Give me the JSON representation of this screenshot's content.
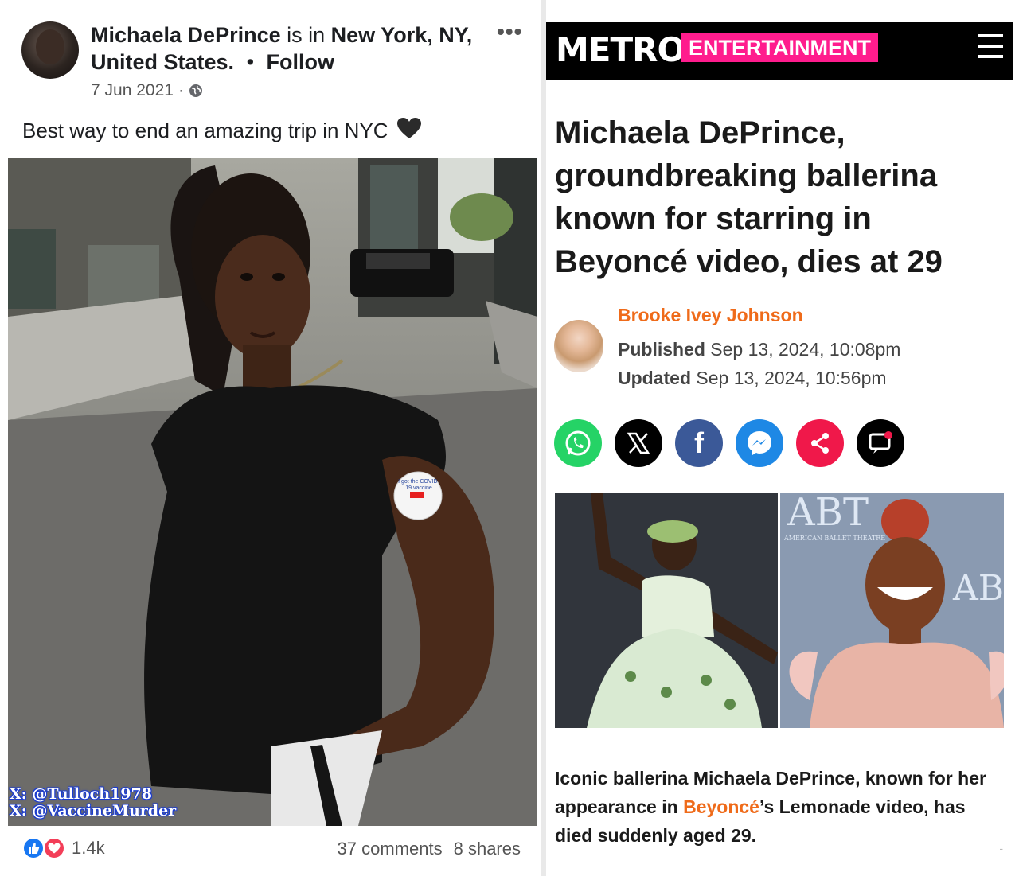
{
  "post": {
    "author": "Michaela DePrince",
    "is_in": "is in",
    "location": "New York, NY, United States.",
    "follow": "Follow",
    "date": "7 Jun 2021",
    "date_sep": "·",
    "more": "•••",
    "caption": "Best way to end an amazing trip in NYC",
    "caption_emoji": "black-heart",
    "watermark_line1": "X: @Tulloch1978",
    "watermark_line2": "X: @VaccineMurder",
    "sticker_text": "I got the COVID-19 vaccine",
    "reactions_count": "1.4k",
    "comments": "37 comments",
    "shares": "8 shares"
  },
  "article": {
    "brand": "METRO",
    "section": "ENTERTAINMENT",
    "headline": "Michaela DePrince, groundbreaking ballerina known for starring in Beyoncé video, dies at 29",
    "author": "Brooke Ivey Johnson",
    "published_label": "Published",
    "published_value": "Sep 13, 2024, 10:08pm",
    "updated_label": "Updated",
    "updated_value": "Sep 13, 2024, 10:56pm",
    "photo_signage": "ABT",
    "photo_signage_sub": "AMERICAN BALLET THEATRE",
    "summary_before": "Iconic ballerina Michaela DePrince, known for her appearance in ",
    "summary_link": "Beyoncé",
    "summary_after": "’s Lemonade video, has died suddenly aged 29.",
    "share_icons": [
      "whatsapp-icon",
      "x-icon",
      "facebook-icon",
      "messenger-icon",
      "share-icon",
      "comment-icon"
    ]
  },
  "colors": {
    "metro_pink": "#ff1c8d",
    "author_orange": "#ef6b1a",
    "fb_like_blue": "#1877f2",
    "fb_love_red": "#f33e58",
    "watermark_outline": "#1b3cd0"
  }
}
